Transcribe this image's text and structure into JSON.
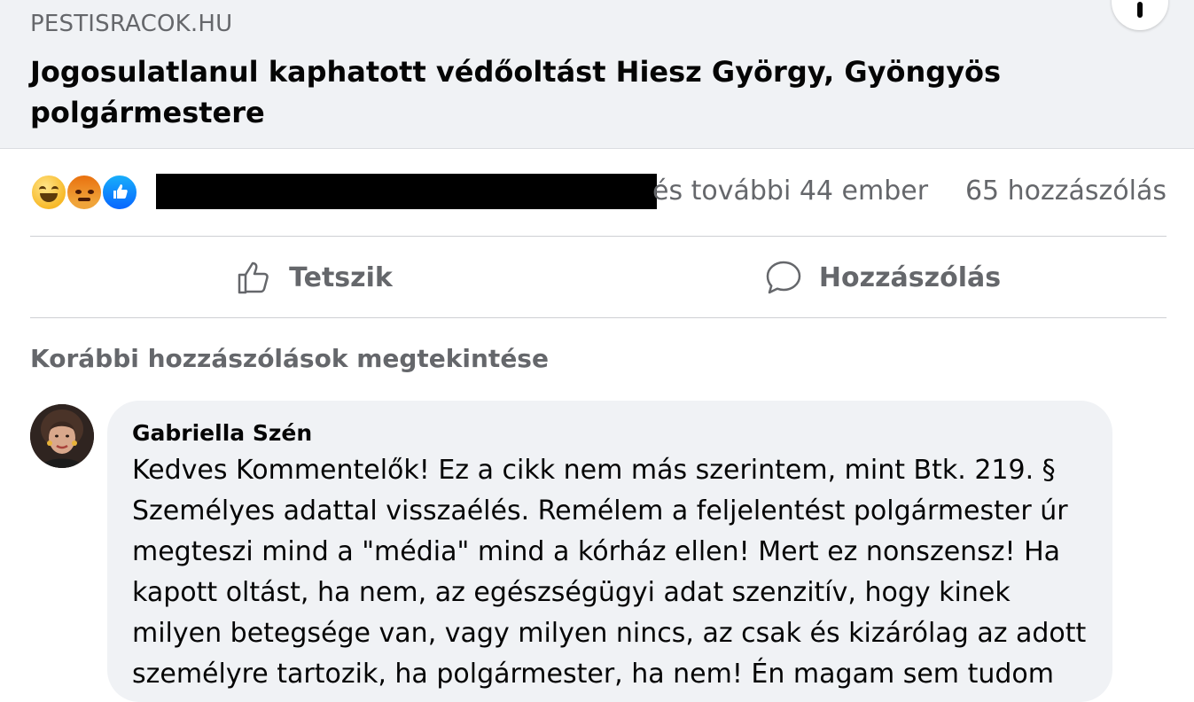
{
  "link_preview": {
    "source": "PESTISRACOK.HU",
    "headline": "Jogosulatlanul kaphatott védőoltást Hiesz György, Gyöngyös polgármestere"
  },
  "reactions": {
    "icons": [
      "haha-reaction-icon",
      "angry-reaction-icon",
      "like-reaction-icon"
    ],
    "reactors_text": "és további 44 ember",
    "comment_count": "65 hozzászólás"
  },
  "actions": {
    "like_label": "Tetszik",
    "comment_label": "Hozzászólás"
  },
  "comments_section": {
    "previous_link": "Korábbi hozzászólások megtekintése",
    "comments": [
      {
        "author": "Gabriella Szén",
        "text": "Kedves Kommentelők! Ez a cikk nem más szerintem, mint Btk. 219. § Személyes adattal visszaélés. Remélem a feljelentést polgármester úr megteszi mind a \"média\" mind a kórház ellen! Mert ez nonszensz! Ha kapott oltást, ha nem, az egészségügyi adat szenzitív, hogy kinek milyen betegsége van, vagy milyen nincs, az csak és kizárólag az adott személyre tartozik, ha polgármester, ha nem! Én magam sem tudom"
      }
    ]
  },
  "colors": {
    "secondary_text": "#65676b",
    "bubble_bg": "#f0f2f5",
    "like_blue": "#0866ff",
    "haha_yellow": "#f7b928",
    "angry_orange": "#e9710f"
  }
}
